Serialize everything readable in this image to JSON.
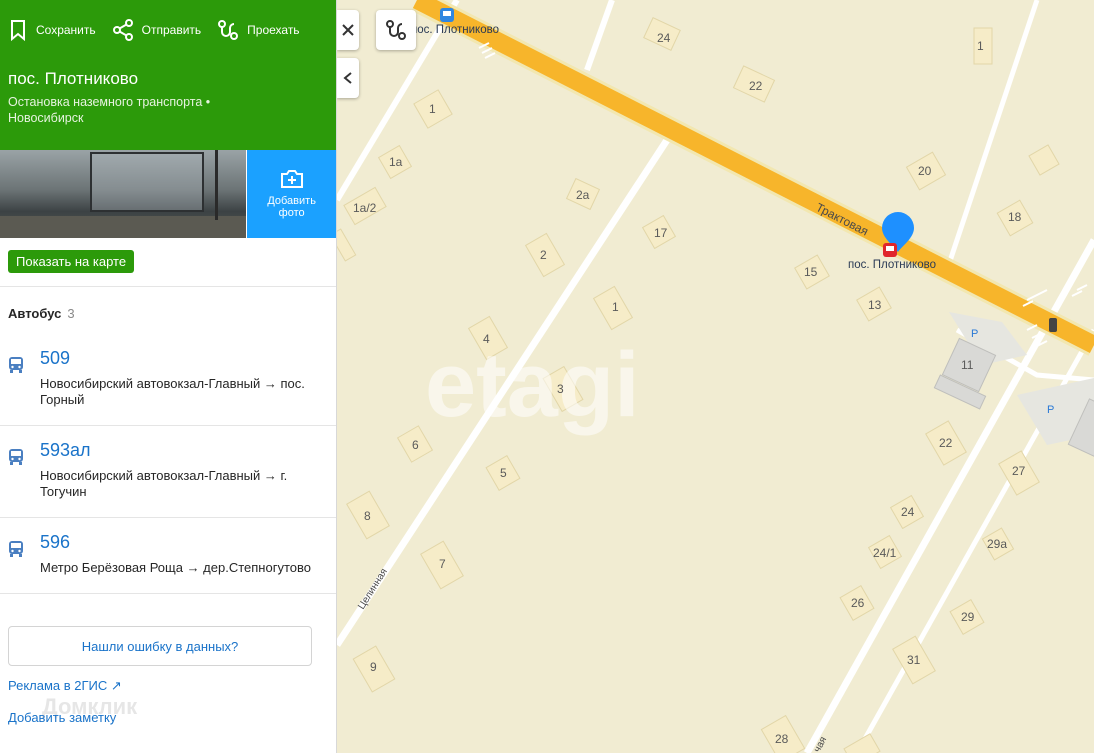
{
  "header": {
    "actions": [
      {
        "label": "Сохранить",
        "icon": "bookmark-icon"
      },
      {
        "label": "Отправить",
        "icon": "share-icon"
      },
      {
        "label": "Проехать",
        "icon": "route-icon"
      }
    ],
    "title": "пос. Плотниково",
    "subtitle_type": "Остановка наземного транспорта •",
    "subtitle_city": "Новосибирск",
    "add_photo_label": "Добавить фото"
  },
  "show_on_map_label": "Показать на карте",
  "section": {
    "title": "Автобус",
    "count": "3"
  },
  "routes": [
    {
      "number": "509",
      "description": "Новосибирский автовокзал-Главный → пос. Горный"
    },
    {
      "number": "593ал",
      "description": "Новосибирский автовокзал-Главный → г. Тогучин"
    },
    {
      "number": "596",
      "description": "Метро Берёзовая Роща → дер.Степногутово"
    }
  ],
  "error_button_label": "Нашли ошибку в данных?",
  "ad_link_label": "Реклама в 2ГИС ↗",
  "add_note_label": "Добавить заметку",
  "overlay_watermark": "Домклик",
  "map": {
    "watermark": "etagi",
    "stop_label": "пос. Плотниково",
    "top_stop_label": "пос. Плотниково",
    "street_main": "Трактовая",
    "street_side": "Целинная",
    "street_bottom": "чая",
    "parking": "P",
    "buildings": [
      "24",
      "22",
      "1",
      "1",
      "1а",
      "1а/2",
      "2а",
      "2",
      "17",
      "20",
      "18",
      "15",
      "13",
      "1",
      "4",
      "3",
      "11",
      "6",
      "5",
      "22",
      "27",
      "8",
      "24",
      "24/1",
      "29а",
      "7",
      "26",
      "29",
      "31",
      "9",
      "28"
    ],
    "colors": {
      "road": "#f7b52b",
      "land": "#f1ecd2",
      "pin": "#1e90ff",
      "header": "#2c9a0a"
    }
  }
}
